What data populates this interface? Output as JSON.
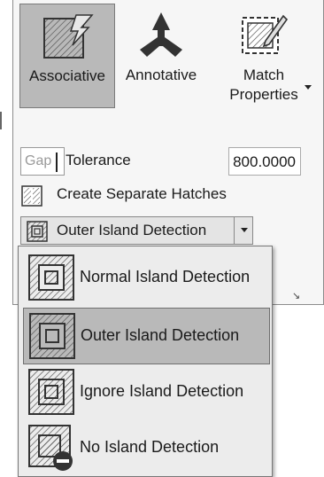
{
  "ribbon": {
    "associative": {
      "label": "Associative",
      "icon": "hatch-associative-icon",
      "active": true
    },
    "annotative": {
      "label": "Annotative",
      "icon": "annotative-icon"
    },
    "match_properties": {
      "line1": "Match",
      "line2": "Properties",
      "icon": "match-properties-icon",
      "dropdown_icon": "caret-down-icon"
    }
  },
  "gap_tolerance": {
    "input_text": "Gap",
    "label": "Tolerance",
    "value": "800.0000"
  },
  "separate_hatches": {
    "label": "Create Separate Hatches",
    "icon": "separate-hatches-icon"
  },
  "island_detection": {
    "selected": "Outer Island Detection",
    "options": [
      {
        "label": "Normal Island Detection",
        "icon": "normal-island-icon",
        "selected": false
      },
      {
        "label": "Outer Island Detection",
        "icon": "outer-island-icon",
        "selected": true
      },
      {
        "label": "Ignore Island Detection",
        "icon": "ignore-island-icon",
        "selected": false
      },
      {
        "label": "No Island Detection",
        "icon": "no-island-icon",
        "selected": false
      }
    ]
  },
  "colors": {
    "panel_bg": "#f6f6f6",
    "selected_bg": "#b9b9b9",
    "menu_bg": "#ececec"
  }
}
